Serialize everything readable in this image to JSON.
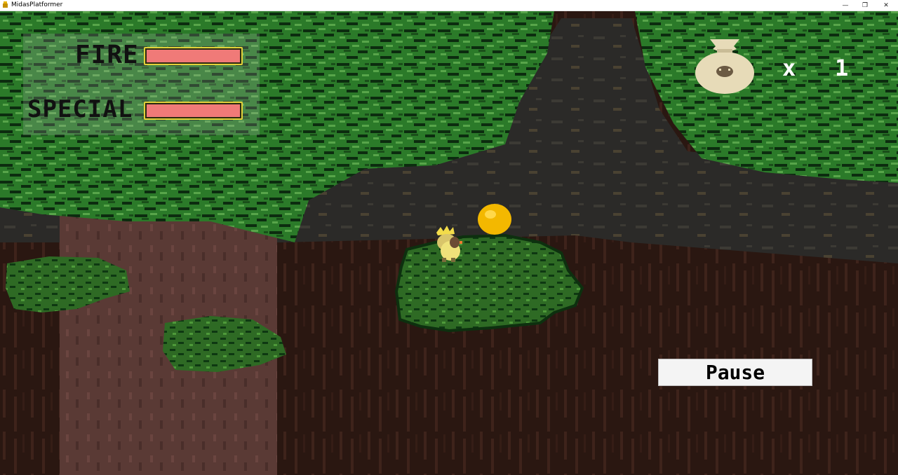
{
  "window": {
    "title": "MidasPlatformer"
  },
  "hud": {
    "fire": {
      "label": "FIRE",
      "level": 1.0
    },
    "special": {
      "label": "SPECIAL",
      "level": 1.0
    },
    "bag": {
      "icon": "money-bag-icon",
      "multiplier": "x",
      "count": "1"
    }
  },
  "controls": {
    "pause_label": "Pause"
  },
  "colors": {
    "canopy": "#2b7a29",
    "canopy_dark": "#0c2c0f",
    "bark_gray": "#2b2a28",
    "ground": "#2a1711",
    "trunk": "#5a3a35",
    "bar_fill": "#f07a78",
    "bar_border": "#e2d23a",
    "coin": "#f3b800"
  }
}
